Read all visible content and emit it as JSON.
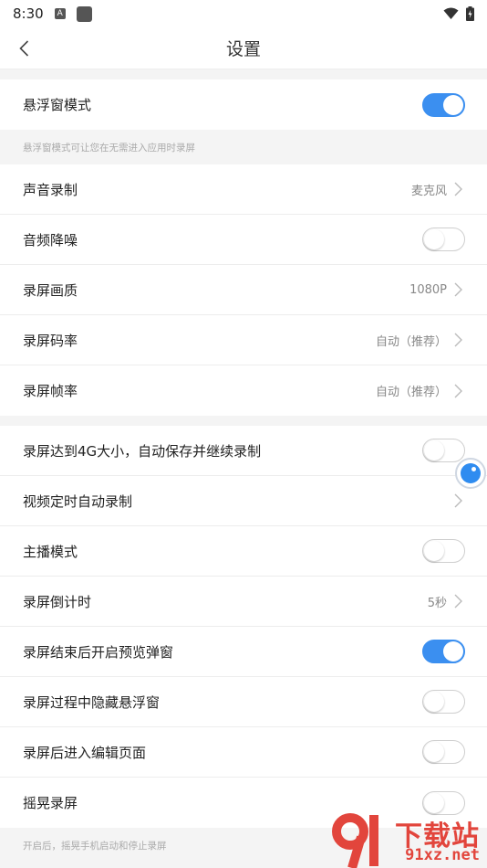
{
  "status_bar": {
    "time": "8:30",
    "notif_a": "A"
  },
  "header": {
    "title": "设置"
  },
  "floating_section": {
    "label": "悬浮窗模式",
    "toggle_on": true,
    "note": "悬浮窗模式可让您在无需进入应用时录屏"
  },
  "audio_video_section": [
    {
      "label": "声音录制",
      "value": "麦克风",
      "type": "link"
    },
    {
      "label": "音频降噪",
      "type": "toggle",
      "on": false
    },
    {
      "label": "录屏画质",
      "value": "1080P",
      "type": "link"
    },
    {
      "label": "录屏码率",
      "value": "自动（推荐）",
      "type": "link"
    },
    {
      "label": "录屏帧率",
      "value": "自动（推荐）",
      "type": "link"
    }
  ],
  "other_section": [
    {
      "label": "录屏达到4G大小，自动保存并继续录制",
      "type": "toggle",
      "on": false
    },
    {
      "label": "视频定时自动录制",
      "type": "link",
      "value": ""
    },
    {
      "label": "主播模式",
      "type": "toggle",
      "on": false
    },
    {
      "label": "录屏倒计时",
      "value": "5秒",
      "type": "link"
    },
    {
      "label": "录屏结束后开启预览弹窗",
      "type": "toggle",
      "on": true
    },
    {
      "label": "录屏过程中隐藏悬浮窗",
      "type": "toggle",
      "on": false
    },
    {
      "label": "录屏后进入编辑页面",
      "type": "toggle",
      "on": false
    },
    {
      "label": "摇晃录屏",
      "type": "toggle",
      "on": false
    }
  ],
  "shake_note": "开启后，摇晃手机启动和停止录屏",
  "watermark": {
    "text": "下载站",
    "domain": "91xz.net",
    "brand_color": "#e2453c"
  },
  "colors": {
    "accent": "#3b8ff0"
  }
}
